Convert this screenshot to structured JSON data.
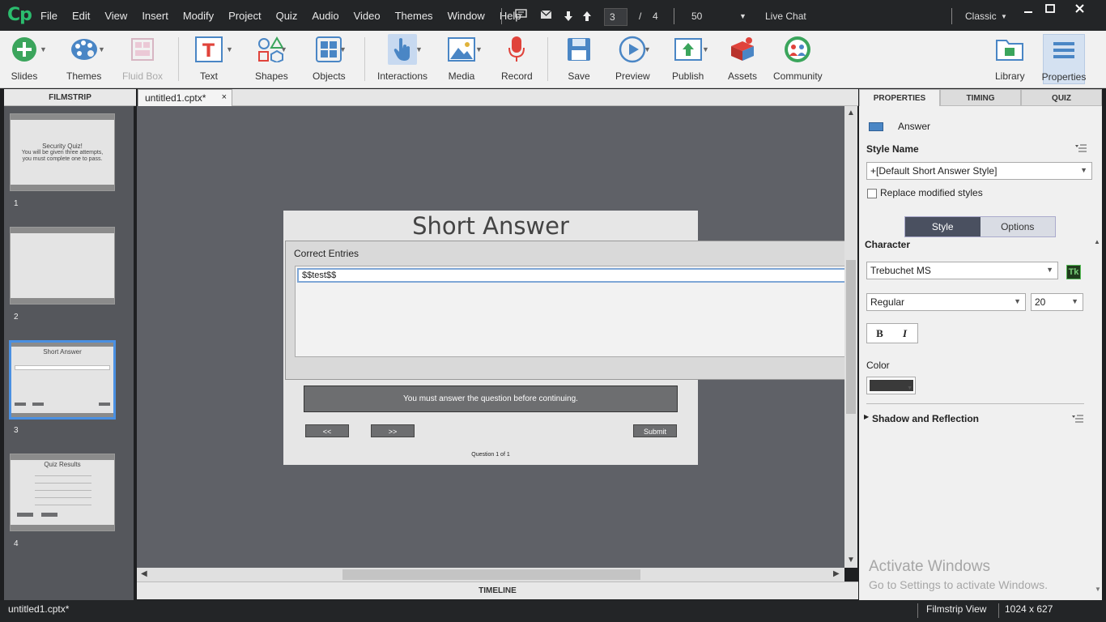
{
  "menubar": {
    "logo": "Cp",
    "items": [
      "File",
      "Edit",
      "View",
      "Insert",
      "Modify",
      "Project",
      "Quiz",
      "Audio",
      "Video",
      "Themes",
      "Window",
      "Help"
    ],
    "current_slide": "3",
    "slide_sep": "/",
    "total_slides": "4",
    "zoom": "50",
    "live_chat": "Live Chat",
    "workspace": "Classic"
  },
  "toolbar": {
    "slides": "Slides",
    "themes": "Themes",
    "fluid_box": "Fluid Box",
    "text": "Text",
    "shapes": "Shapes",
    "objects": "Objects",
    "interactions": "Interactions",
    "media": "Media",
    "record": "Record",
    "save": "Save",
    "preview": "Preview",
    "publish": "Publish",
    "assets": "Assets",
    "community": "Community",
    "library": "Library",
    "properties": "Properties"
  },
  "filmstrip": {
    "header": "FILMSTRIP",
    "slides": [
      {
        "num": "1",
        "title": "Security Quiz!",
        "line1": "You will be given three attempts,",
        "line2": "you must complete one to pass."
      },
      {
        "num": "2"
      },
      {
        "num": "3",
        "title": "Short Answer"
      },
      {
        "num": "4",
        "title": "Quiz Results"
      }
    ]
  },
  "document": {
    "tab_name": "untitled1.cptx*",
    "close": "×"
  },
  "slide": {
    "title": "Short Answer",
    "correct_entries_label": "Correct Entries",
    "entry_value": "$$test$$",
    "message": "You must answer the question before continuing.",
    "back_button": "<<",
    "next_button": ">>",
    "submit_button": "Submit",
    "question_count": "Question 1 of 1"
  },
  "timeline": {
    "label": "TIMELINE"
  },
  "properties": {
    "tabs": [
      "PROPERTIES",
      "TIMING",
      "QUIZ"
    ],
    "object_name": "Answer",
    "style_name_label": "Style Name",
    "style_name_value": "+[Default Short Answer Style]",
    "replace_modified": "Replace modified styles",
    "seg_style": "Style",
    "seg_options": "Options",
    "character_label": "Character",
    "font_family": "Trebuchet MS",
    "tk": "Tk",
    "font_style": "Regular",
    "font_size": "20",
    "bold": "B",
    "italic": "I",
    "color_label": "Color",
    "shadow_label": "Shadow and Reflection"
  },
  "status": {
    "file": "untitled1.cptx*",
    "view": "Filmstrip View",
    "dimensions": "1024 x 627"
  },
  "watermark": {
    "line1": "Activate Windows",
    "line2": "Go to Settings to activate Windows."
  }
}
